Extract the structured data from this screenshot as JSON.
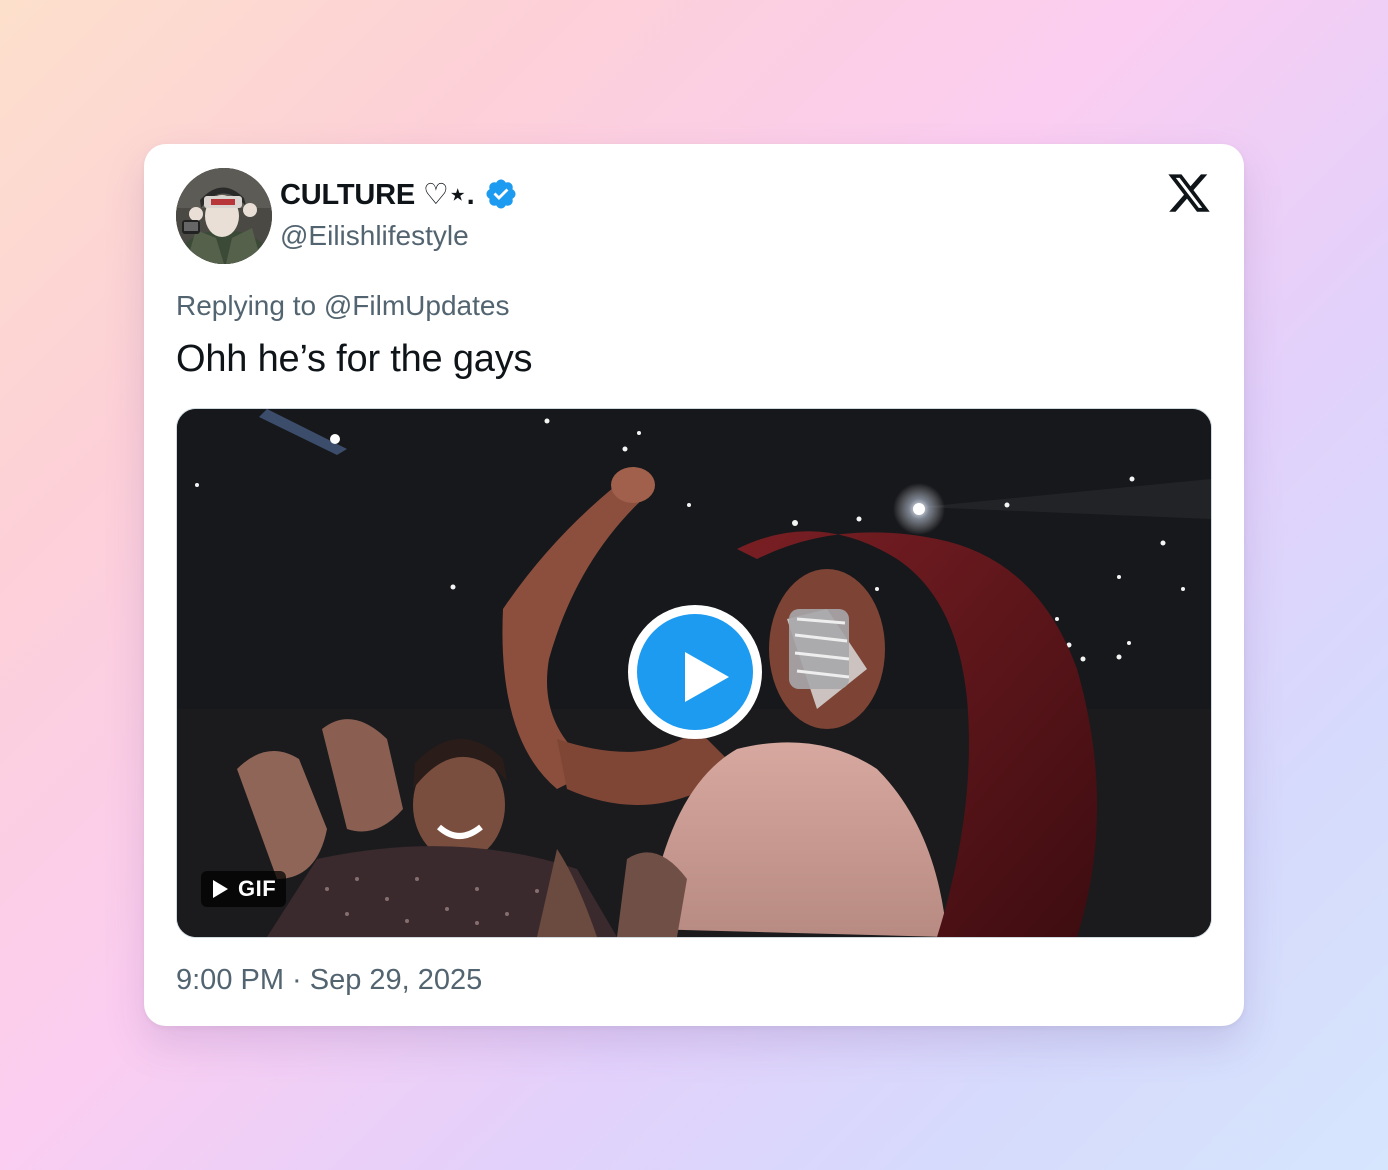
{
  "tweet": {
    "display_name": "CULTURE ♡⋆.",
    "handle": "@Eilishlifestyle",
    "verified": true,
    "replying_to": "Replying to @FilmUpdates",
    "text": "Ohh he’s for the gays",
    "media": {
      "type": "GIF",
      "badge_label": "GIF"
    },
    "timestamp": "9:00 PM · Sep 29, 2025"
  },
  "icons": {
    "platform_logo": "x-logo-icon",
    "verified_badge": "verified-badge-icon",
    "play": "play-icon"
  },
  "colors": {
    "accent": "#1d9bf0",
    "text_primary": "#0f1419",
    "text_secondary": "#536471"
  }
}
